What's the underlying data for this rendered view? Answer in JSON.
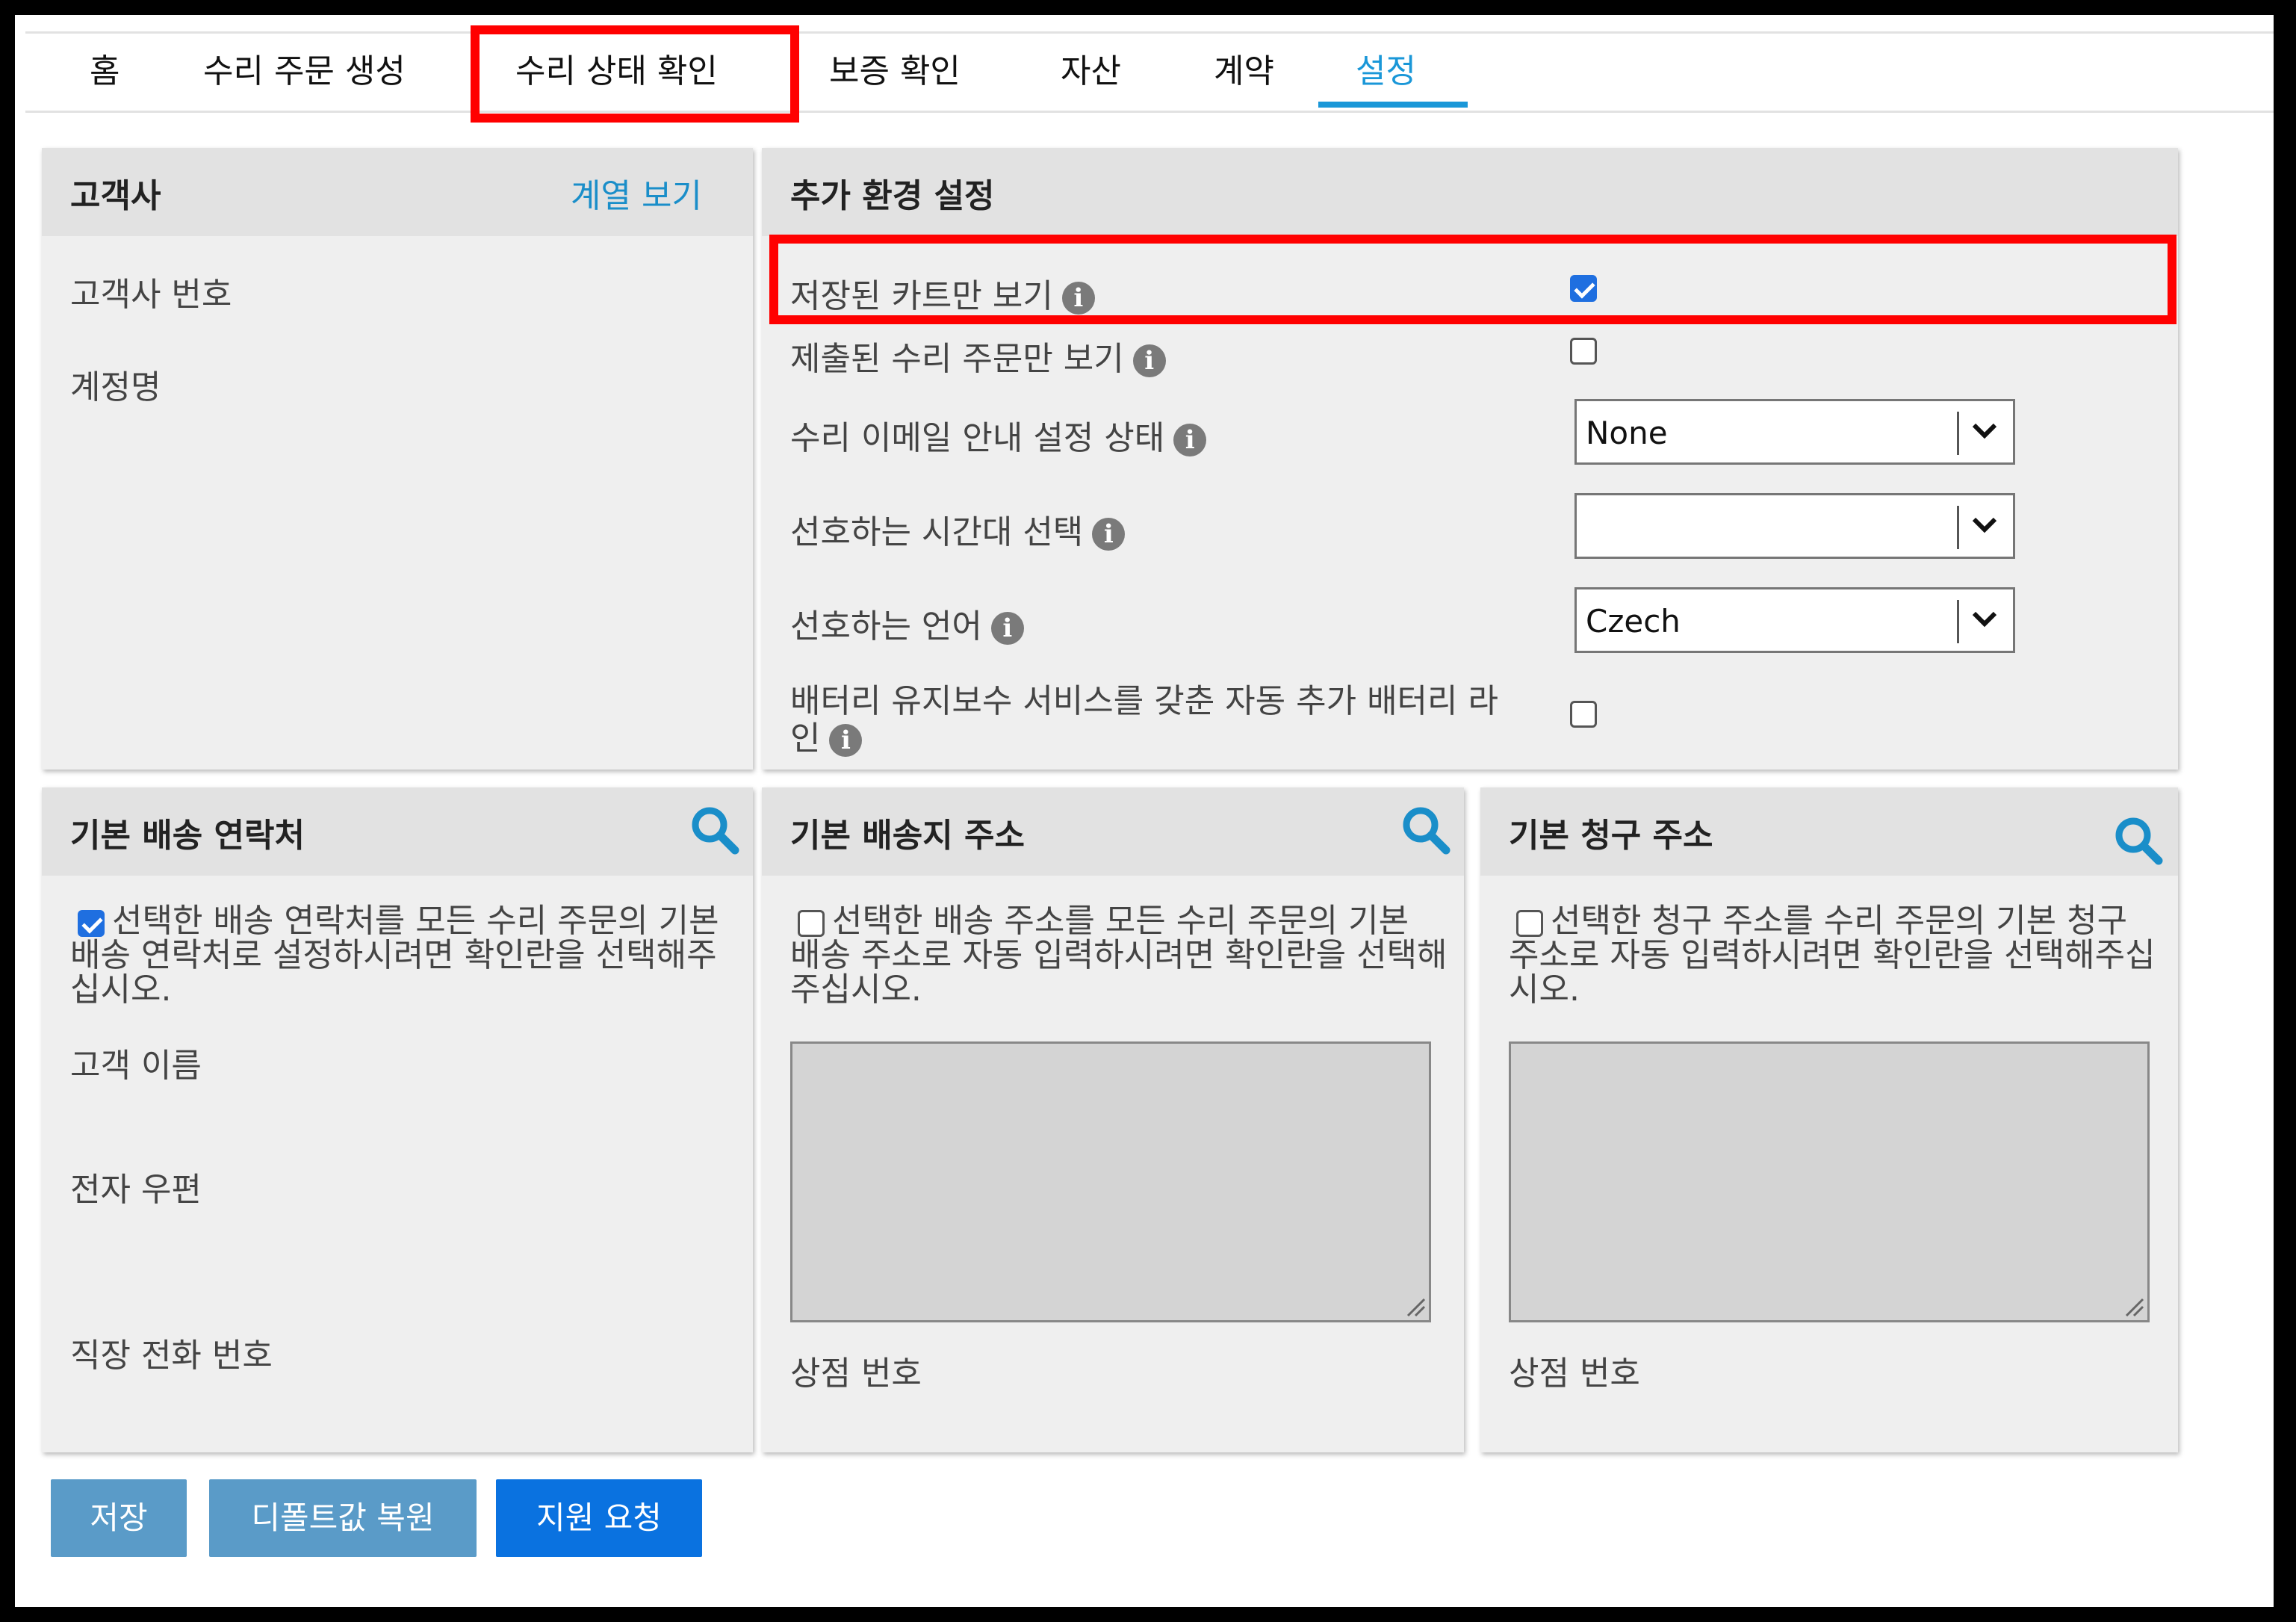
{
  "nav": {
    "tabs": [
      {
        "label": "홈"
      },
      {
        "label": "수리 주문 생성"
      },
      {
        "label": "수리 상태 확인"
      },
      {
        "label": "보증 확인"
      },
      {
        "label": "자산"
      },
      {
        "label": "계약"
      },
      {
        "label": "설정"
      }
    ],
    "active_tab": "설정"
  },
  "customer_panel": {
    "title": "고객사",
    "link": "계열 보기",
    "fields": [
      "고객사 번호",
      "계정명"
    ]
  },
  "settings_panel": {
    "title": "추가 환경 설정",
    "rows": [
      {
        "label": "저장된 카트만 보기",
        "checked": true
      },
      {
        "label": "제출된 수리 주문만 보기",
        "checked": false
      },
      {
        "label": "수리 이메일 안내 설정 상태",
        "value": "None"
      },
      {
        "label": "선호하는 시간대 선택",
        "value": ""
      },
      {
        "label": "선호하는 언어",
        "value": "Czech"
      },
      {
        "label_line1": "배터리 유지보수 서비스를 갖춘 자동 추가 배터리 라",
        "label_line2": "인",
        "checked": false
      }
    ],
    "info_icon": "i"
  },
  "shipping_contact_panel": {
    "title": "기본 배송 연락처",
    "checkbox_checked": true,
    "desc": "선택한 배송 연락처를 모든 수리 주문의 기본 배송 연락처로 설정하시려면 확인란을 선택해주십시오.",
    "fields": [
      "고객 이름",
      "전자 우편",
      "직장 전화 번호"
    ]
  },
  "shipping_address_panel": {
    "title": "기본 배송지 주소",
    "checkbox_checked": false,
    "desc": "선택한 배송 주소를 모든 수리 주문의 기본 배송 주소로 자동 입력하시려면 확인란을 선택해주십시오.",
    "store_label": "상점 번호"
  },
  "billing_address_panel": {
    "title": "기본 청구 주소",
    "checkbox_checked": false,
    "desc": "선택한 청구 주소를 수리 주문의 기본 청구 주소로 자동 입력하시려면 확인란을 선택해주십시오.",
    "store_label": "상점 번호"
  },
  "buttons": {
    "save": "저장",
    "restore_default": "디폴트값 복원",
    "support": "지원 요청"
  },
  "colors": {
    "accent": "#1a97d8",
    "highlight": "#ff0000",
    "button_light": "#5a9bc8",
    "button_dark": "#0a72e0"
  }
}
